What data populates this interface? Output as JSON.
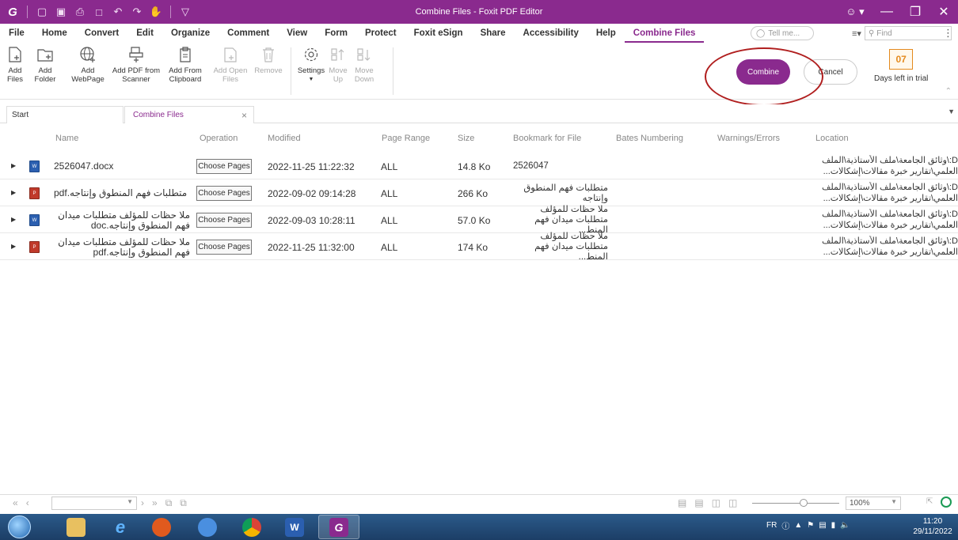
{
  "window": {
    "title": "Combine Files - Foxit PDF Editor"
  },
  "menu": {
    "items": [
      "File",
      "Home",
      "Convert",
      "Edit",
      "Organize",
      "Comment",
      "View",
      "Form",
      "Protect",
      "Foxit eSign",
      "Share",
      "Accessibility",
      "Help",
      "Combine Files"
    ],
    "tell_me_placeholder": "Tell me...",
    "find_placeholder": "Find"
  },
  "ribbon": {
    "add_files": "Add Files",
    "add_folder": "Add Folder",
    "add_webpage": "Add WebPage",
    "add_pdf_scanner": "Add PDF from Scanner",
    "add_from_clipboard": "Add From Clipboard",
    "add_open_files": "Add Open Files",
    "remove": "Remove",
    "settings": "Settings",
    "move_up": "Move Up",
    "move_down": "Move Down",
    "combine": "Combine",
    "cancel": "Cancel",
    "trial_days": "07",
    "trial_label": "Days left in trial"
  },
  "tabs": {
    "start": "Start",
    "combine_files": "Combine Files"
  },
  "columns": {
    "name": "Name",
    "operation": "Operation",
    "modified": "Modified",
    "page_range": "Page Range",
    "size": "Size",
    "bookmark": "Bookmark for File",
    "bates": "Bates Numbering",
    "warnings": "Warnings/Errors",
    "location": "Location"
  },
  "rows": [
    {
      "name": "2526047.docx",
      "operation": "Choose Pages",
      "modified": "2022-11-25 11:22:32",
      "range": "ALL",
      "size": "14.8 Ko",
      "bookmark": "2526047",
      "location_line1": "D:\\وثائق الجامعة\\ملف الأستاذية\\الملف",
      "location_line2": "العلمي\\تقارير خبرة مقالات\\إشكالات..."
    },
    {
      "name": "متطلبات فهم المنطوق وإنتاجه.pdf",
      "operation": "Choose Pages",
      "modified": "2022-09-02 09:14:28",
      "range": "ALL",
      "size": "266 Ko",
      "bookmark": "متطلبات فهم المنطوق وإنتاجه",
      "location_line1": "D:\\وثائق الجامعة\\ملف الأستاذية\\الملف",
      "location_line2": "العلمي\\تقارير خبرة مقالات\\إشكالات..."
    },
    {
      "name": "ملا حظات للمؤلف متطلبات ميدان فهم المنطوق وإنتاجه.doc",
      "operation": "Choose Pages",
      "modified": "2022-09-03 10:28:11",
      "range": "ALL",
      "size": "57.0 Ko",
      "bookmark": "ملا حظات للمؤلف متطلبات ميدان فهم المنط...",
      "location_line1": "D:\\وثائق الجامعة\\ملف الأستاذية\\الملف",
      "location_line2": "العلمي\\تقارير خبرة مقالات\\إشكالات..."
    },
    {
      "name": "ملا حظات للمؤلف متطلبات ميدان فهم المنطوق وإنتاجه.pdf",
      "operation": "Choose Pages",
      "modified": "2022-11-25 11:32:00",
      "range": "ALL",
      "size": "174 Ko",
      "bookmark": "ملا حظات للمؤلف متطلبات ميدان فهم المنط...",
      "location_line1": "D:\\وثائق الجامعة\\ملف الأستاذية\\الملف",
      "location_line2": "العلمي\\تقارير خبرة مقالات\\إشكالات..."
    }
  ],
  "statusbar": {
    "zoom": "100%"
  },
  "taskbar": {
    "lang": "FR",
    "time": "11:20",
    "date": "29/11/2022"
  },
  "colors": {
    "brand": "#8a2a8e",
    "annotation_red": "#b01e1e"
  }
}
